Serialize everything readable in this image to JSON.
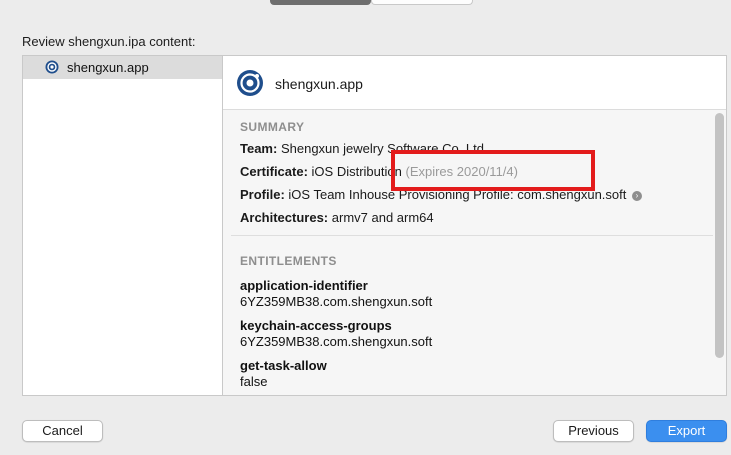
{
  "dialog": {
    "review_label": "Review shengxun.ipa content:"
  },
  "app_list": {
    "items": [
      {
        "label": "shengxun.app",
        "icon": "app-icon"
      }
    ]
  },
  "detail": {
    "app_name": "shengxun.app",
    "summary": {
      "title": "SUMMARY",
      "team_label": "Team:",
      "team_value": "Shengxun jewelry Software Co. Ltd.",
      "certificate_label": "Certificate:",
      "certificate_value": "iOS Distribution",
      "certificate_expiry": "(Expires 2020/11/4)",
      "profile_label": "Profile:",
      "profile_value": "iOS Team Inhouse Provisioning Profile: com.shengxun.soft",
      "architectures_label": "Architectures:",
      "architectures_value": "armv7 and arm64"
    },
    "entitlements": {
      "title": "ENTITLEMENTS",
      "items": [
        {
          "key": "application-identifier",
          "value": "6YZ359MB38.com.shengxun.soft"
        },
        {
          "key": "keychain-access-groups",
          "value": "6YZ359MB38.com.shengxun.soft"
        },
        {
          "key": "get-task-allow",
          "value": "false"
        }
      ]
    }
  },
  "buttons": {
    "cancel": "Cancel",
    "previous": "Previous",
    "export": "Export"
  },
  "colors": {
    "accent": "#3b8fef",
    "annotation": "#e31b1b"
  }
}
